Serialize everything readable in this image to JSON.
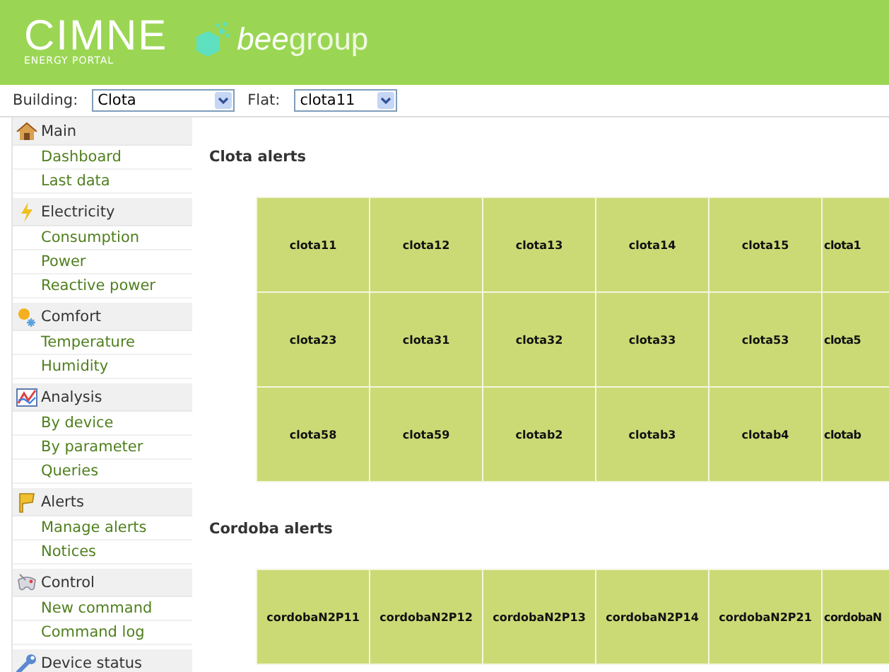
{
  "header": {
    "logo_title": "CIMNE",
    "logo_subtitle": "ENERGY PORTAL",
    "brand_lead": "bee",
    "brand_tail": "group"
  },
  "filters": [
    {
      "label": "Building:",
      "value": "Clota"
    },
    {
      "label": "Flat:",
      "value": "clota11"
    }
  ],
  "sidebar": {
    "sections": [
      {
        "title": "Main",
        "items": [
          {
            "label": "Dashboard"
          },
          {
            "label": "Last data"
          }
        ]
      },
      {
        "title": "Electricity",
        "items": [
          {
            "label": "Consumption"
          },
          {
            "label": "Power"
          },
          {
            "label": "Reactive power"
          }
        ]
      },
      {
        "title": "Comfort",
        "items": [
          {
            "label": "Temperature"
          },
          {
            "label": "Humidity"
          }
        ]
      },
      {
        "title": "Analysis",
        "items": [
          {
            "label": "By device"
          },
          {
            "label": "By parameter"
          },
          {
            "label": "Queries"
          }
        ]
      },
      {
        "title": "Alerts",
        "items": [
          {
            "label": "Manage alerts"
          },
          {
            "label": "Notices"
          }
        ]
      },
      {
        "title": "Control",
        "items": [
          {
            "label": "New command"
          },
          {
            "label": "Command log"
          }
        ]
      },
      {
        "title": "Device status"
      }
    ]
  },
  "alert_groups": [
    {
      "title": "Clota alerts",
      "rows": [
        [
          "clota11",
          "clota12",
          "clota13",
          "clota14",
          "clota15",
          "clota1"
        ],
        [
          "clota23",
          "clota31",
          "clota32",
          "clota33",
          "clota53",
          "clota5"
        ],
        [
          "clota58",
          "clota59",
          "clotab2",
          "clotab3",
          "clotab4",
          "clotab"
        ]
      ]
    },
    {
      "title": "Cordoba alerts",
      "rows": [
        [
          "cordobaN2P11",
          "cordobaN2P12",
          "cordobaN2P13",
          "cordobaN2P14",
          "cordobaN2P21",
          "cordobaN"
        ]
      ]
    }
  ]
}
